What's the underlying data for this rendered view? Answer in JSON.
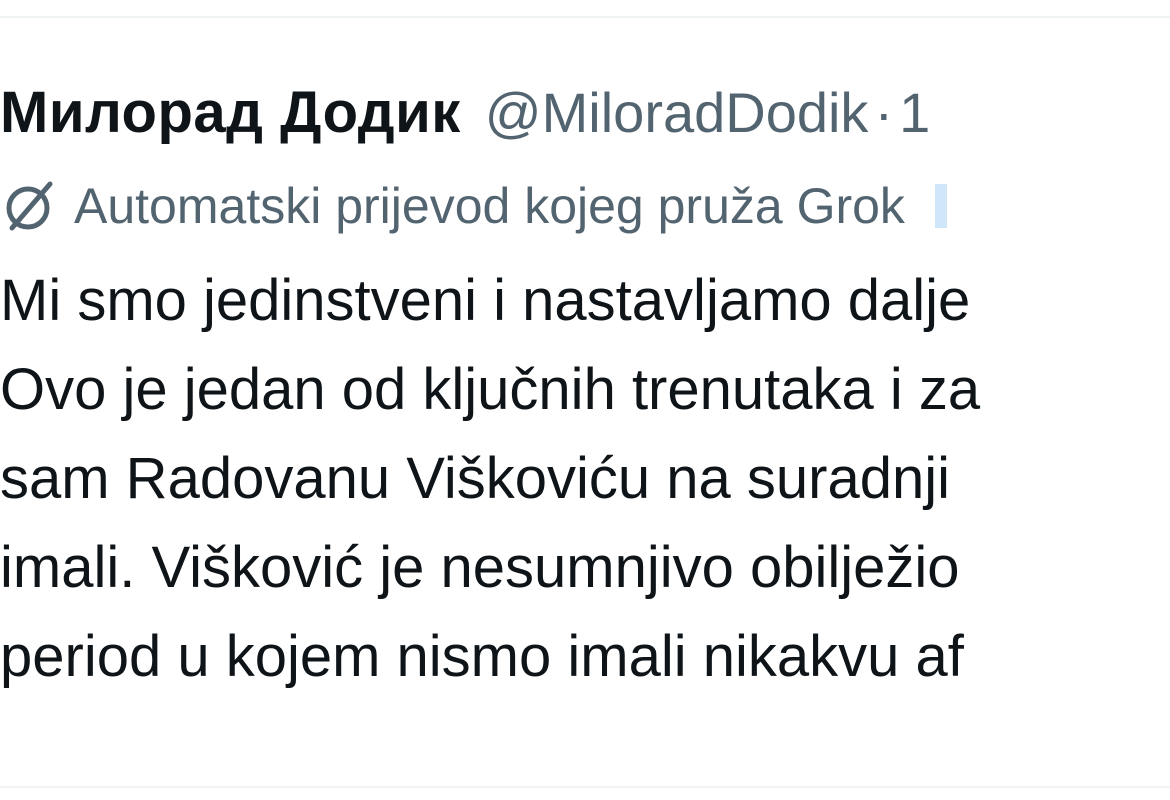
{
  "tweet": {
    "author": {
      "display_name": "Милорад Додик",
      "handle": "@MiloradDodik",
      "separator": "·",
      "timestamp": "1"
    },
    "translation_notice": {
      "icon": "grok-icon",
      "text": "Automatski prijevod kojeg pruža Grok"
    },
    "body_lines": [
      "Mi smo jedinstveni i nastavljamo dalje",
      "Ovo je jedan od ključnih trenutaka i za",
      "sam Radovanu Viškoviću na suradnji",
      "imali. Višković je nesumnjivo obilježio",
      "period u kojem nismo imali nikakvu af"
    ]
  },
  "colors": {
    "text_primary": "#0f1419",
    "text_secondary": "#536471",
    "divider": "#eff3f4"
  }
}
